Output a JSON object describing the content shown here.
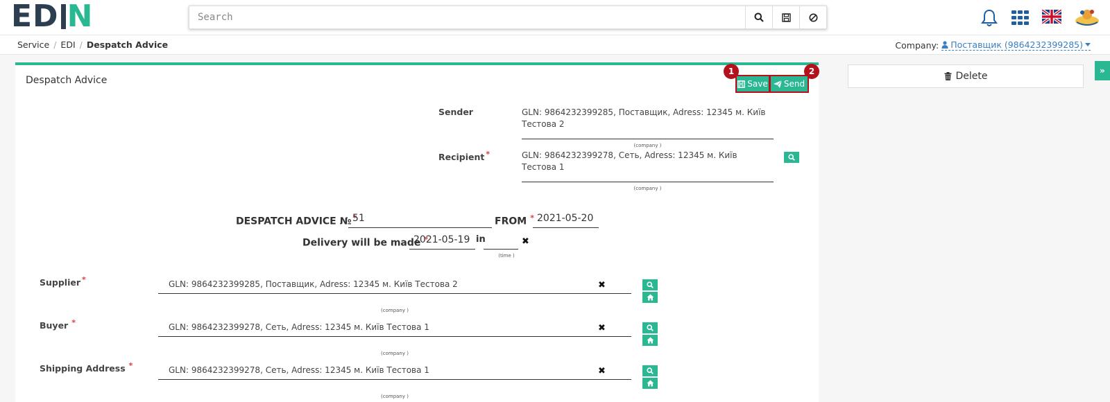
{
  "header": {
    "logo_left": "ED",
    "logo_right": "N",
    "search_placeholder": "Search",
    "icons": [
      "search-icon",
      "save-icon",
      "cancel-icon",
      "bell-icon",
      "apps-grid-icon",
      "uk-flag-icon",
      "user-avatar-icon"
    ]
  },
  "breadcrumb": {
    "items": [
      "Service",
      "EDI"
    ],
    "current": "Despatch Advice"
  },
  "company": {
    "label": "Company:",
    "value": "Поставщик (9864232399285)"
  },
  "panel": {
    "title": "Despatch Advice",
    "save_label": "Save",
    "send_label": "Send",
    "badge1": "1",
    "badge2": "2"
  },
  "sender": {
    "label": "Sender",
    "value_line1": "GLN: 9864232399285, Поставщик, Adress: 12345 м. Київ",
    "value_line2": "Тестова 2",
    "hint": "(company )"
  },
  "recipient": {
    "label": "Recipient",
    "value_line1": "GLN: 9864232399278, Сеть, Adress: 12345 м. Київ",
    "value_line2": "Тестова 1",
    "hint": "(company )"
  },
  "doc": {
    "number_label": "DESPATCH ADVICE №",
    "number_value": "51",
    "from_label": "FROM",
    "from_value": "2021-05-20",
    "delivery_label": "Delivery will be made",
    "delivery_date": "2021-05-19",
    "in_label": "in",
    "time_value": "",
    "time_hint": "(time )"
  },
  "parties": [
    {
      "label": "Supplier",
      "value": "GLN: 9864232399285, Поставщик, Adress: 12345 м. Київ Тестова 2",
      "hint": "(company )"
    },
    {
      "label": "Buyer",
      "value": "GLN: 9864232399278, Сеть, Adress: 12345 м. Київ Тестова 1",
      "hint": "(company )"
    },
    {
      "label": "Shipping Address",
      "value": "GLN: 9864232399278, Сеть, Adress: 12345 м. Київ Тестова 1",
      "hint": "(company )"
    }
  ],
  "sidebar": {
    "delete_label": "Delete",
    "expand_label": "»"
  },
  "colors": {
    "accent": "#2ab893",
    "brand_dark": "#2c3e50",
    "highlight": "#b3121c",
    "link": "#3a7ec4"
  }
}
